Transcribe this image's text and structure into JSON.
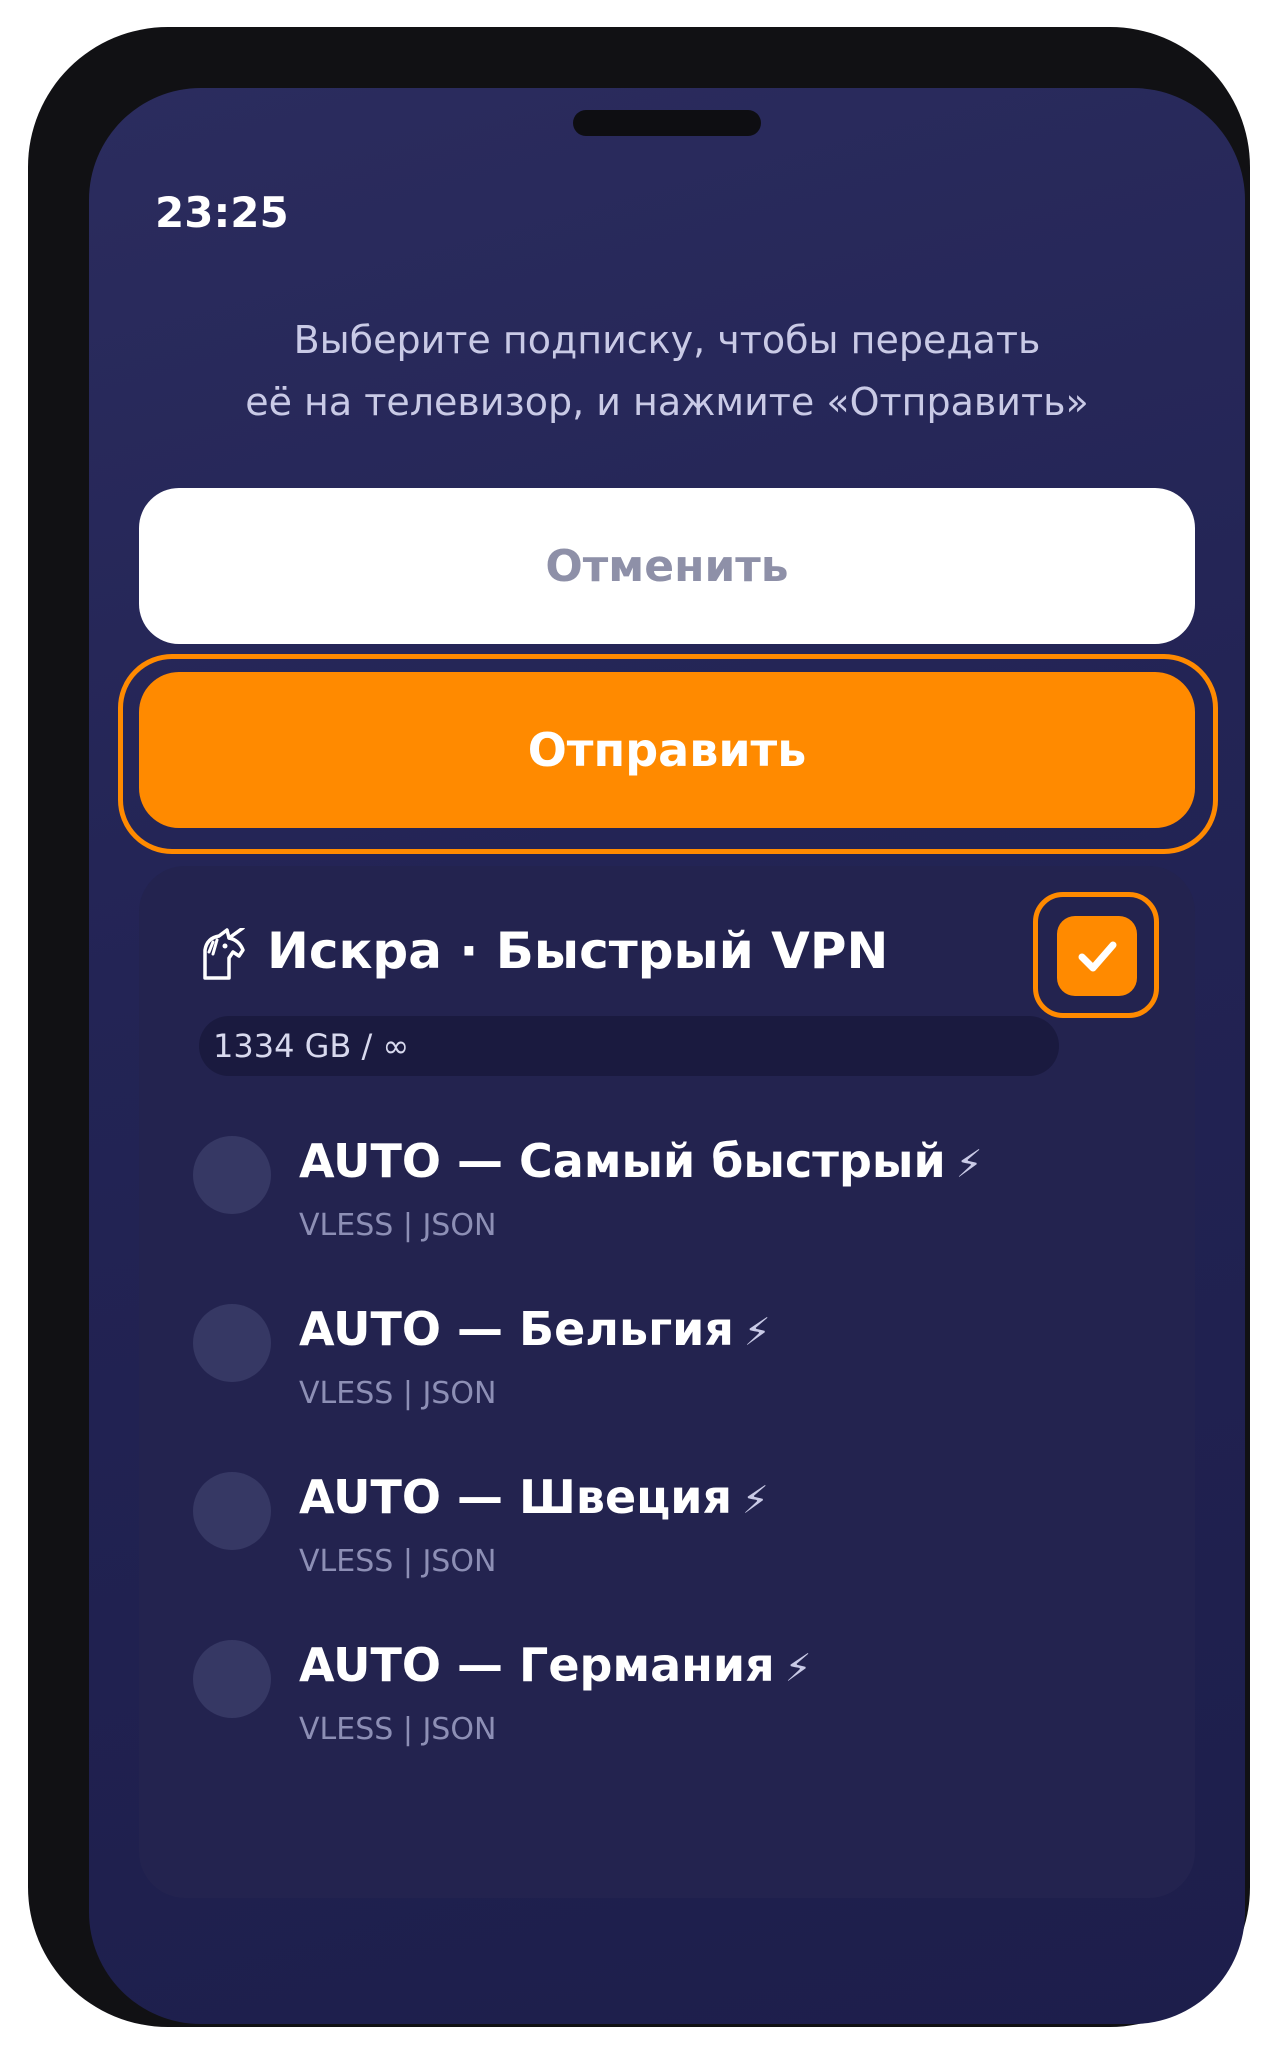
{
  "status_bar": {
    "time": "23:25"
  },
  "instruction": {
    "line1": "Выберите подписку, чтобы передать",
    "line2": "её на телевизор, и нажмите «Отправить»"
  },
  "buttons": {
    "cancel_label": "Отменить",
    "send_label": "Отправить"
  },
  "subscription": {
    "icon": "unicorn-icon",
    "title": "Искра · Быстрый VPN",
    "checked": true,
    "traffic": "1334 GB / ∞",
    "servers": [
      {
        "name": "AUTO — Самый быстрый",
        "bolt": "⚡",
        "protocol": "VLESS | JSON"
      },
      {
        "name": "AUTO — Бельгия",
        "bolt": "⚡",
        "protocol": "VLESS | JSON"
      },
      {
        "name": "AUTO — Швеция",
        "bolt": "⚡",
        "protocol": "VLESS | JSON"
      },
      {
        "name": "AUTO — Германия",
        "bolt": "⚡",
        "protocol": "VLESS | JSON"
      }
    ]
  },
  "colors": {
    "accent": "#ff8a00",
    "background": "#23244f",
    "card": "#23234f"
  }
}
